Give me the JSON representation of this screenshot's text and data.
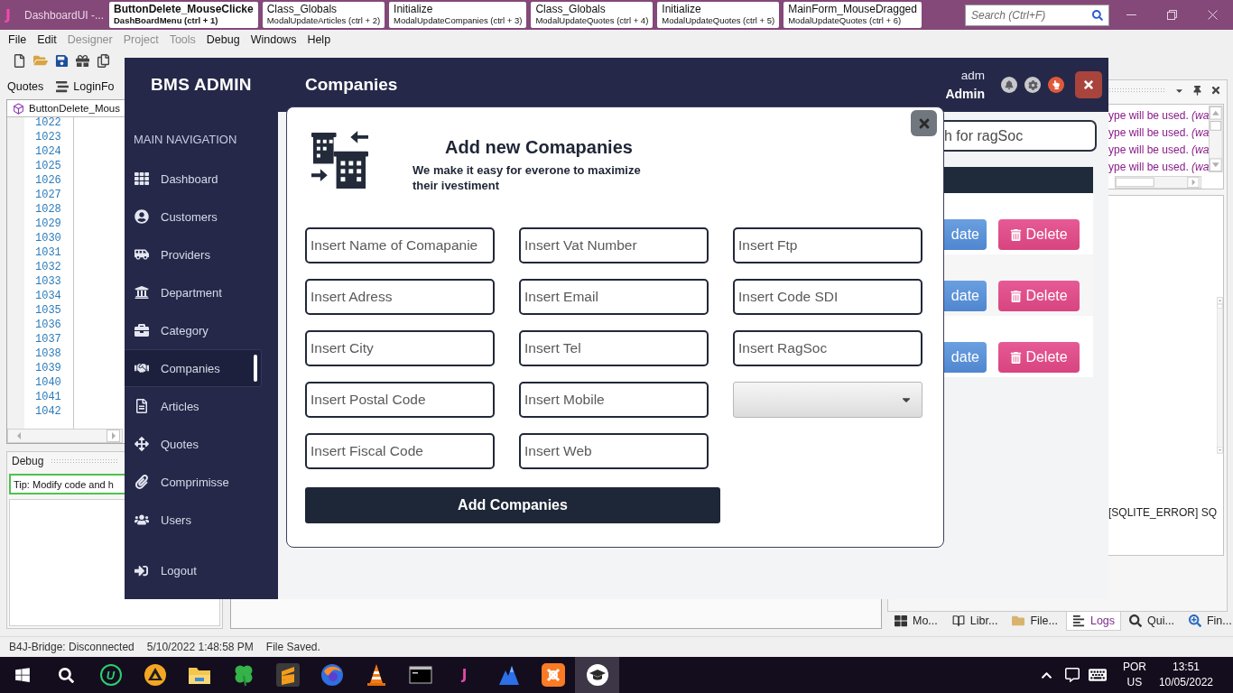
{
  "ide": {
    "title_bar": {
      "logo": "J",
      "title": "DashboardUI -...",
      "tabs": [
        {
          "title": "ButtonDelete_MouseClicke",
          "subtitle": "DashBoardMenu (ctrl + 1)",
          "selected": true
        },
        {
          "title": "Class_Globals",
          "subtitle": "ModalUpdateArticles (ctrl + 2)",
          "selected": false
        },
        {
          "title": "Initialize",
          "subtitle": "ModalUpdateCompanies (ctrl + 3)",
          "selected": false
        },
        {
          "title": "Class_Globals",
          "subtitle": "ModalUpdateQuotes (ctrl + 4)",
          "selected": false
        },
        {
          "title": "Initialize",
          "subtitle": "ModalUpdateQuotes (ctrl + 5)",
          "selected": false
        },
        {
          "title": "MainForm_MouseDragged",
          "subtitle": "ModalUpdateQuotes (ctrl + 6)",
          "selected": false
        }
      ],
      "search": {
        "placeholder": "Search (Ctrl+F)"
      }
    },
    "menu": [
      {
        "label": "File",
        "disabled": false
      },
      {
        "label": "Edit",
        "disabled": false
      },
      {
        "label": "Designer",
        "disabled": true
      },
      {
        "label": "Project",
        "disabled": true
      },
      {
        "label": "Tools",
        "disabled": true
      },
      {
        "label": "Debug",
        "disabled": false
      },
      {
        "label": "Windows",
        "disabled": false
      },
      {
        "label": "Help",
        "disabled": false
      }
    ],
    "editor_tabs": [
      "Quotes",
      "LoginFo"
    ],
    "editor": {
      "tab": "ButtonDelete_Mous",
      "line_numbers": [
        "1022",
        "1023",
        "1024",
        "1025",
        "1026",
        "1027",
        "1028",
        "1029",
        "1030",
        "1031",
        "1032",
        "1033",
        "1034",
        "1035",
        "1036",
        "1037",
        "1038",
        "1039",
        "1040",
        "1041",
        "1042"
      ]
    },
    "debug": {
      "title": "Debug",
      "tip": "Tip: Modify code and h"
    },
    "logs": {
      "lines": [
        "ype will be used. *(wa*",
        "ype will be used. *(wa*",
        "ype will be used. *(wa*",
        "ype will be used. *(wa*"
      ],
      "error_line": "[SQLITE_ERROR] SQ"
    },
    "bottom_tabs": [
      {
        "label": "Mo...",
        "selected": false
      },
      {
        "label": "Libr...",
        "selected": false
      },
      {
        "label": "File...",
        "selected": false
      },
      {
        "label": "Logs",
        "selected": true
      },
      {
        "label": "Qui...",
        "selected": false
      },
      {
        "label": "Fin...",
        "selected": false
      }
    ],
    "status_bar": [
      "B4J-Bridge: Disconnected",
      "5/10/2022 1:48:58 PM",
      "File Saved."
    ]
  },
  "app": {
    "brand": "BMS ADMIN",
    "nav_heading": "MAIN NAVIGATION",
    "nav": [
      {
        "label": "Dashboard",
        "selected": false
      },
      {
        "label": "Customers",
        "selected": false
      },
      {
        "label": "Providers",
        "selected": false
      },
      {
        "label": "Department",
        "selected": false
      },
      {
        "label": "Category",
        "selected": false
      },
      {
        "label": "Companies",
        "selected": true
      },
      {
        "label": "Articles",
        "selected": false
      },
      {
        "label": "Quotes",
        "selected": false
      },
      {
        "label": "Comprimisse",
        "selected": false
      },
      {
        "label": "Users",
        "selected": false
      }
    ],
    "logout": "Logout",
    "page_title": "Companies",
    "user": {
      "name": "adm",
      "role": "Admin"
    },
    "search": {
      "placeholder": "h for ragSoc"
    },
    "table": {
      "rows": [
        {
          "update": "date",
          "delete": "Delete"
        },
        {
          "update": "date",
          "delete": "Delete"
        },
        {
          "update": "date",
          "delete": "Delete"
        }
      ]
    },
    "modal": {
      "title": "Add new Comapanies",
      "subtitle": "We make it easy for everone to maximize their ivestiment",
      "fields": [
        {
          "kind": "input",
          "placeholder": "Insert Name of Comapanie"
        },
        {
          "kind": "input",
          "placeholder": "Insert Vat Number"
        },
        {
          "kind": "input",
          "placeholder": "Insert Ftp"
        },
        {
          "kind": "input",
          "placeholder": "Insert Adress"
        },
        {
          "kind": "input",
          "placeholder": "Insert Email"
        },
        {
          "kind": "input",
          "placeholder": "Insert Code SDI"
        },
        {
          "kind": "input",
          "placeholder": "Insert City"
        },
        {
          "kind": "input",
          "placeholder": "Insert Tel"
        },
        {
          "kind": "input",
          "placeholder": "Insert RagSoc"
        },
        {
          "kind": "input",
          "placeholder": "Insert Postal Code"
        },
        {
          "kind": "input",
          "placeholder": "Insert Mobile"
        },
        {
          "kind": "select"
        },
        {
          "kind": "input",
          "placeholder": "Insert Fiscal Code"
        },
        {
          "kind": "input",
          "placeholder": "Insert Web"
        }
      ],
      "submit": "Add Companies"
    }
  },
  "taskbar": {
    "apps": [
      {
        "glyph": "U",
        "selected": false
      },
      {
        "selected": false
      },
      {
        "selected": false
      },
      {
        "selected": false
      },
      {
        "selected": false
      },
      {
        "selected": false
      },
      {
        "selected": false
      },
      {
        "selected": false
      },
      {
        "glyph": "J",
        "selected": false
      },
      {
        "selected": false
      },
      {
        "selected": false
      },
      {
        "selected": true
      }
    ],
    "language": [
      "POR",
      "US"
    ],
    "time": "13:51",
    "date": "10/05/2022"
  }
}
